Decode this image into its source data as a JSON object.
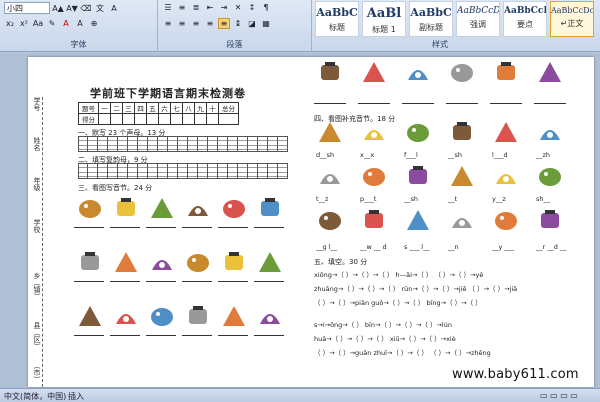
{
  "ribbon": {
    "font_size": "小四",
    "group_font": "字体",
    "group_paragraph": "段落",
    "group_styles": "样式",
    "styles": [
      {
        "sample": "AaBbC",
        "name": "标题"
      },
      {
        "sample": "AaBl",
        "name": "标题 1"
      },
      {
        "sample": "AaBbC",
        "name": "副标题"
      },
      {
        "sample": "AaBbCcD",
        "name": "强调"
      },
      {
        "sample": "AaBbCcD",
        "name": "要点"
      },
      {
        "sample": "AaBbCcDc",
        "name": "↵正文"
      }
    ]
  },
  "doc": {
    "title": "学前班下学期语言期末检测卷",
    "side_labels": [
      "学号",
      "姓名",
      "年级",
      "学校",
      "乡（镇）",
      "县（区）",
      "（市）"
    ],
    "score_header": [
      "题号",
      "一",
      "二",
      "三",
      "四",
      "五",
      "六",
      "七",
      "八",
      "九",
      "十",
      "总分"
    ],
    "score_row_label": "得分",
    "q1": "一、默写 23 个声母。13 分",
    "q2": "二、填写复韵母，9 分",
    "q3": "三、看图写音节。24 分",
    "q4": "四、看图补充音节。18 分",
    "q5": "五、填空。30 分",
    "fill_row1": [
      "d__sh",
      "x__x",
      "f___l",
      "__sh",
      "l___d",
      "__zh"
    ],
    "fill_row2": [
      "t__z",
      "p___t",
      "__sh",
      "__t",
      "y__z",
      "sh__"
    ],
    "fill_row3": [
      "__g l__",
      "__w __ d",
      "s ___ l__",
      "__n",
      "__y ___",
      "__r __d __"
    ],
    "pinyin_lines": [
      "xiōng→（ ）→（ ）→（ ）    h—āi→（ ）     （ ）→（ ）→yě",
      "zhuāng→（ ）→（ ）→（ ）    rūn→（ ）→（ ）→jiē      （ ）→（ ）→jiǎ",
      "（ ）→（ ）→piān    guǒ→（ ）→（ ）    bīng→（ ）→（ ）",
      "s→i→ōng→（ ）     bīn→（ ）→（ ）→（ ）→lún",
      "huā→（ ）→（ ）→（ ）    xiū→（ ）→（ ）→xiè",
      "（ ）→（ ）→guān    zhuī→（ ）→（ ）    （ ）→（ ）→zhēng"
    ]
  },
  "status": {
    "language": "中文(简体，中国)",
    "mode": "插入"
  },
  "watermark": "www.baby611.com",
  "colors": {
    "ribbon_top": "#dfe8f5",
    "doc_bg": "#aebfd6",
    "accent": "#e0a030"
  }
}
